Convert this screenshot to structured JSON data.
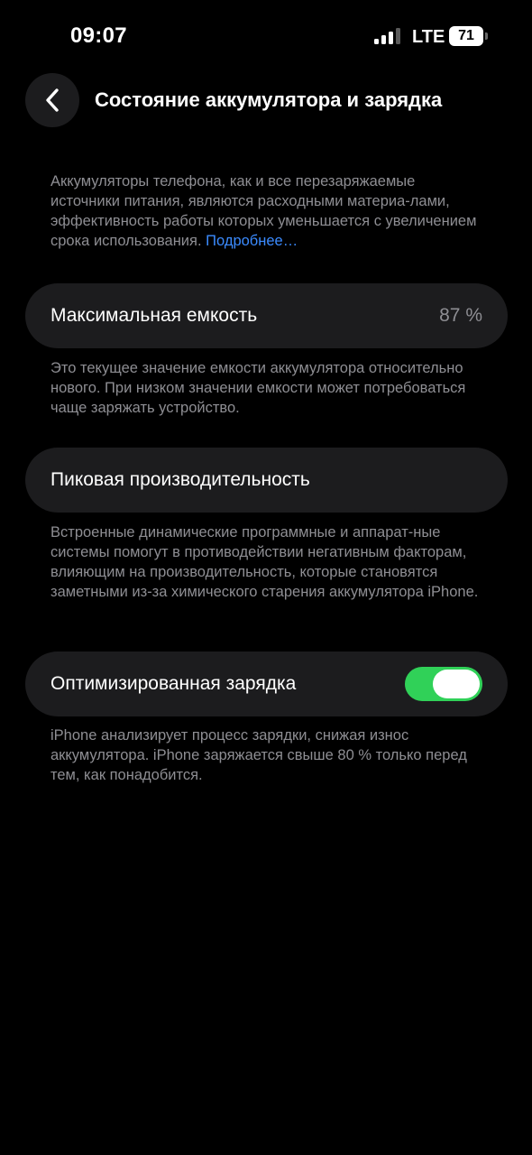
{
  "status_bar": {
    "time": "09:07",
    "network": "LTE",
    "battery_level": "71",
    "signal_icon": "cellular-signal-icon"
  },
  "header": {
    "title": "Состояние аккумулятора и зарядка",
    "back_icon": "chevron-left-icon"
  },
  "intro": {
    "text": "Аккумуляторы телефона, как и все перезаряжаемые источники питания, являются расходными материа-лами, эффективность работы которых уменьшается с увеличением срока использования. ",
    "link": "Подробнее…"
  },
  "max_capacity": {
    "label": "Максимальная емкость",
    "value": "87 %",
    "description": "Это текущее значение емкости аккумулятора относительно нового. При низком значении емкости может потребоваться чаще заряжать устройство."
  },
  "peak_performance": {
    "label": "Пиковая производительность",
    "description": "Встроенные динамические программные и аппарат-ные системы помогут в противодействии негативным факторам, влияющим на производительность, которые становятся заметными из-за химического старения аккумулятора iPhone."
  },
  "optimized_charging": {
    "label": "Оптимизированная зарядка",
    "enabled": true,
    "description": "iPhone анализирует процесс зарядки, снижая износ аккумулятора. iPhone заряжается свыше 80 % только перед тем, как понадобится."
  },
  "colors": {
    "background": "#000000",
    "card": "#1c1c1e",
    "secondary_text": "#8e8e93",
    "link": "#3b8bff",
    "toggle_on": "#30d158"
  }
}
